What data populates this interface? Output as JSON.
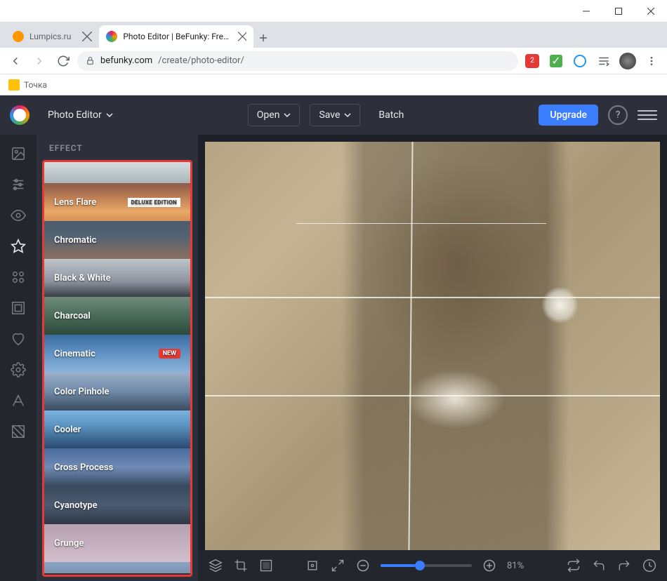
{
  "window": {
    "minimize": "–",
    "maximize": "□",
    "close": "✕"
  },
  "tabs": {
    "inactive": {
      "title": "Lumpics.ru"
    },
    "active": {
      "title": "Photo Editor | BeFunky: Free Onl"
    },
    "add": "+"
  },
  "toolbar": {
    "url_host": "befunky.com",
    "url_path": "/create/photo-editor/",
    "badge_count": "2"
  },
  "bookmarks": {
    "item1": "Точка"
  },
  "app_header": {
    "photo_editor": "Photo Editor",
    "open": "Open",
    "save": "Save",
    "batch": "Batch",
    "upgrade": "Upgrade",
    "help": "?"
  },
  "panel": {
    "title": "EFFECT"
  },
  "effects": [
    {
      "label": "",
      "badge": ""
    },
    {
      "label": "Lens Flare",
      "badge": "DELUXE EDITION"
    },
    {
      "label": "Chromatic",
      "badge": ""
    },
    {
      "label": "Black & White",
      "badge": ""
    },
    {
      "label": "Charcoal",
      "badge": ""
    },
    {
      "label": "Cinematic",
      "badge": "NEW"
    },
    {
      "label": "Color Pinhole",
      "badge": ""
    },
    {
      "label": "Cooler",
      "badge": ""
    },
    {
      "label": "Cross Process",
      "badge": ""
    },
    {
      "label": "Cyanotype",
      "badge": ""
    },
    {
      "label": "Grunge",
      "badge": ""
    }
  ],
  "bottom": {
    "zoom_percent": "81%"
  }
}
